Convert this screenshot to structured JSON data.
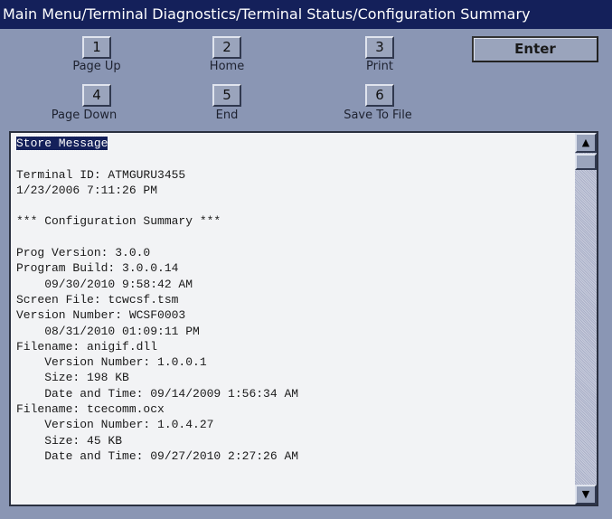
{
  "title": "Main Menu/Terminal Diagnostics/Terminal Status/Configuration Summary",
  "buttons": [
    {
      "key": "1",
      "label": "Page Up"
    },
    {
      "key": "2",
      "label": "Home"
    },
    {
      "key": "3",
      "label": "Print"
    },
    {
      "key": "4",
      "label": "Page Down"
    },
    {
      "key": "5",
      "label": "End"
    },
    {
      "key": "6",
      "label": "Save To File"
    }
  ],
  "enter_label": "Enter",
  "content": {
    "selected_line": "Store Message",
    "lines": [
      "",
      "Terminal ID: ATMGURU3455",
      "1/23/2006 7:11:26 PM",
      "",
      "*** Configuration Summary ***",
      "",
      "Prog Version: 3.0.0",
      "Program Build: 3.0.0.14",
      "    09/30/2010 9:58:42 AM",
      "Screen File: tcwcsf.tsm",
      "Version Number: WCSF0003",
      "    08/31/2010 01:09:11 PM",
      "Filename: anigif.dll",
      "    Version Number: 1.0.0.1",
      "    Size: 198 KB",
      "    Date and Time: 09/14/2009 1:56:34 AM",
      "Filename: tcecomm.ocx",
      "    Version Number: 1.0.4.27",
      "    Size: 45 KB",
      "    Date and Time: 09/27/2010 2:27:26 AM"
    ]
  },
  "scrollbar": {
    "up_icon": "arrow-up-icon",
    "down_icon": "arrow-down-icon",
    "position_percent": 0
  },
  "colors": {
    "title_bg": "#14205a",
    "panel_bg": "#8a96b4",
    "text_bg": "#f2f3f5"
  }
}
